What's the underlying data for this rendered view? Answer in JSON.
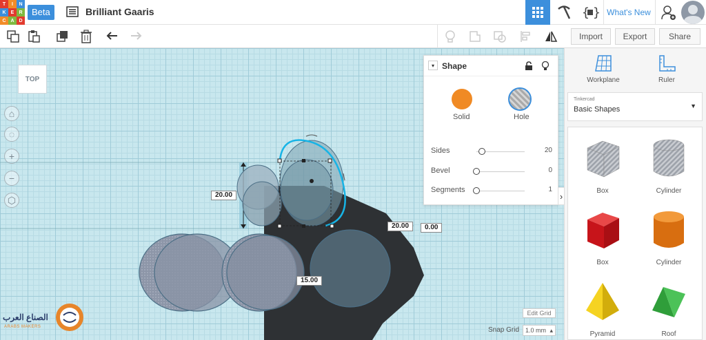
{
  "header": {
    "logo_letters": [
      "TIN",
      "KER",
      "CAD"
    ],
    "beta_label": "Beta",
    "design_title": "Brilliant Gaaris",
    "whats_new_label": "What's New"
  },
  "toolbar": {
    "import_label": "Import",
    "export_label": "Export",
    "share_label": "Share"
  },
  "workplane": {
    "view_label": "TOP",
    "dim_height": "20.00",
    "dim_width": "20.00",
    "dim_offset": "0.00",
    "dim_distance": "15.00",
    "edit_grid_label": "Edit Grid",
    "snap_grid_label": "Snap Grid",
    "snap_grid_value": "1.0 mm"
  },
  "inspector": {
    "title": "Shape",
    "solid_label": "Solid",
    "hole_label": "Hole",
    "params": [
      {
        "label": "Sides",
        "value": "20",
        "position": 0.12
      },
      {
        "label": "Bevel",
        "value": "0",
        "position": 0.0
      },
      {
        "label": "Segments",
        "value": "1",
        "position": 0.0
      }
    ]
  },
  "right_panel": {
    "workplane_label": "Workplane",
    "ruler_label": "Ruler",
    "library_source": "Tinkercad",
    "library_name": "Basic Shapes",
    "shapes": [
      {
        "label": "Box",
        "icon": "box-hole-icon"
      },
      {
        "label": "Cylinder",
        "icon": "cylinder-hole-icon"
      },
      {
        "label": "Box",
        "icon": "box-solid-icon"
      },
      {
        "label": "Cylinder",
        "icon": "cylinder-solid-icon"
      },
      {
        "label": "Pyramid",
        "icon": "pyramid-icon"
      },
      {
        "label": "Roof",
        "icon": "roof-icon"
      }
    ]
  },
  "watermark": {
    "text": "الصناع العرب",
    "sub": "ARABS MAKERS"
  },
  "colors": {
    "accent": "#3c8fdc",
    "solid": "#f08a24",
    "workplane": "#c8e7ee",
    "dark_shape": "#2e3134"
  }
}
